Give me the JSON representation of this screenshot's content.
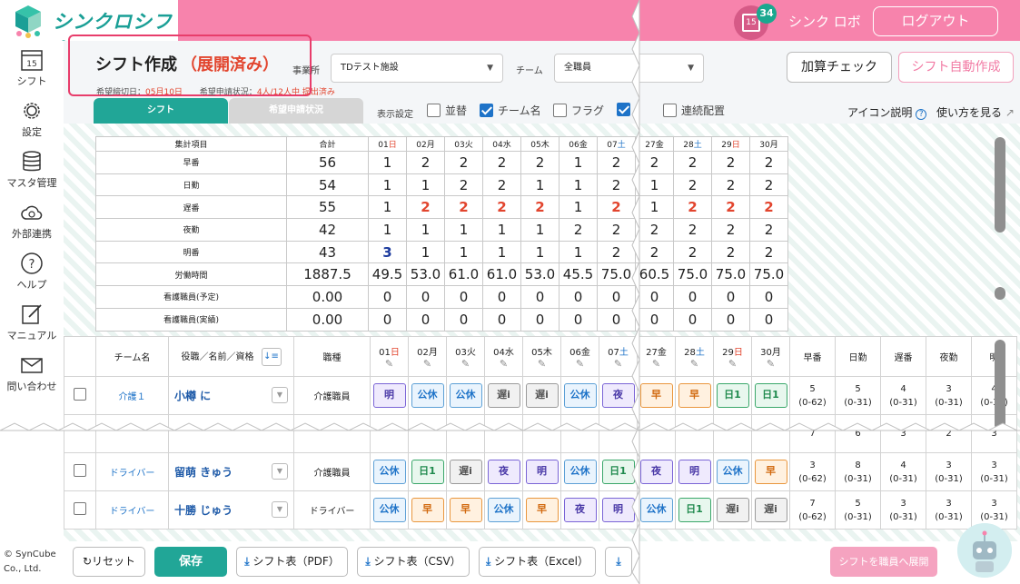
{
  "header": {
    "logo_text": "シンクロシフト",
    "cal_day": "15",
    "notif_count": "34",
    "user": "シンク ロボ",
    "logout": "ログアウト"
  },
  "sidebar": {
    "items": [
      {
        "label": "シフト",
        "icon": "calendar-icon"
      },
      {
        "label": "設定",
        "icon": "gear-icon"
      },
      {
        "label": "マスタ管理",
        "icon": "database-icon"
      },
      {
        "label": "外部連携",
        "icon": "cloud-sync-icon"
      },
      {
        "label": "ヘルプ",
        "icon": "help-icon"
      },
      {
        "label": "マニュアル",
        "icon": "manual-icon"
      },
      {
        "label": "問い合わせ",
        "icon": "mail-icon"
      }
    ],
    "cal_day": "15",
    "copyright_1": "© SynCube",
    "copyright_2": "Co., Ltd."
  },
  "page": {
    "title": "シフト作成",
    "status": "（展開済み）",
    "deadline_label": "希望締切日：",
    "deadline_value": "05月10日",
    "request_label": "希望申請状況：",
    "request_value": "4人/12人中 提出済み",
    "office_label": "事業所",
    "office_value": "TDテスト施設",
    "team_label": "チーム",
    "team_value": "全職員",
    "addon_check": "加算チェック",
    "auto_create": "シフト自動作成"
  },
  "tabs": {
    "shift": "シフト",
    "request": "希望申請状況"
  },
  "display": {
    "label": "表示設定",
    "options": [
      {
        "label": "並替",
        "checked": false
      },
      {
        "label": "チーム名",
        "checked": true
      },
      {
        "label": "フラグ",
        "checked": false
      },
      {
        "label": "",
        "checked": true
      },
      {
        "label": "連続配置",
        "checked": false
      }
    ],
    "icon_help": "アイコン説明",
    "usage": "使い方を見る"
  },
  "summary": {
    "header": {
      "item": "集計項目",
      "total": "合計"
    },
    "days": [
      {
        "num": "01",
        "dow": "日",
        "type": "sun"
      },
      {
        "num": "02",
        "dow": "月",
        "type": ""
      },
      {
        "num": "03",
        "dow": "火",
        "type": ""
      },
      {
        "num": "04",
        "dow": "水",
        "type": ""
      },
      {
        "num": "05",
        "dow": "木",
        "type": ""
      },
      {
        "num": "06",
        "dow": "金",
        "type": ""
      },
      {
        "num": "07",
        "dow": "土",
        "type": "sat"
      },
      {
        "num": "27",
        "dow": "金",
        "type": ""
      },
      {
        "num": "28",
        "dow": "土",
        "type": "sat"
      },
      {
        "num": "29",
        "dow": "日",
        "type": "sun"
      },
      {
        "num": "30",
        "dow": "月",
        "type": ""
      }
    ],
    "rows": [
      {
        "label": "早番",
        "total": "56",
        "values": [
          "1",
          "2",
          "2",
          "2",
          "2",
          "1",
          "2",
          "2",
          "2",
          "2",
          "2"
        ],
        "style": ""
      },
      {
        "label": "日勤",
        "total": "54",
        "values": [
          "1",
          "1",
          "2",
          "2",
          "1",
          "1",
          "2",
          "1",
          "2",
          "2",
          "2"
        ],
        "style": ""
      },
      {
        "label": "遅番",
        "total": "55",
        "values": [
          "1",
          "2",
          "2",
          "2",
          "2",
          "1",
          "2",
          "1",
          "2",
          "2",
          "2"
        ],
        "style": "red"
      },
      {
        "label": "夜勤",
        "total": "42",
        "values": [
          "1",
          "1",
          "1",
          "1",
          "1",
          "2",
          "2",
          "2",
          "2",
          "2",
          "2"
        ],
        "style": ""
      },
      {
        "label": "明番",
        "total": "43",
        "values": [
          "3",
          "1",
          "1",
          "1",
          "1",
          "1",
          "2",
          "2",
          "2",
          "2",
          "2"
        ],
        "style": "first-blue"
      },
      {
        "label": "労働時間",
        "total": "1887.5",
        "values": [
          "49.5",
          "53.0",
          "61.0",
          "61.0",
          "53.0",
          "45.5",
          "75.0",
          "60.5",
          "75.0",
          "75.0",
          "75.0"
        ],
        "style": ""
      },
      {
        "label": "看護職員(予定)",
        "total": "0.00",
        "values": [
          "0",
          "0",
          "0",
          "0",
          "0",
          "0",
          "0",
          "0",
          "0",
          "0",
          "0"
        ],
        "style": ""
      },
      {
        "label": "看護職員(実績)",
        "total": "0.00",
        "values": [
          "0",
          "0",
          "0",
          "0",
          "0",
          "0",
          "0",
          "0",
          "0",
          "0",
          "0"
        ],
        "style": ""
      }
    ]
  },
  "staff": {
    "header": {
      "team": "チーム名",
      "role": "役職／名前／資格",
      "job": "職種"
    },
    "count_headers": [
      "早番",
      "日勤",
      "遅番",
      "夜勤",
      "明"
    ],
    "rows": [
      {
        "team": "介護１",
        "name": "小樽 に",
        "job": "介護職員",
        "shifts": [
          "明",
          "公休",
          "公休",
          "遅i",
          "遅i",
          "公休",
          "夜",
          "早",
          "早",
          "日1",
          "日1"
        ],
        "counts": [
          [
            "5",
            "(0-62)"
          ],
          [
            "5",
            "(0-31)"
          ],
          [
            "4",
            "(0-31)"
          ],
          [
            "3",
            "(0-31)"
          ],
          [
            "4",
            "(0-31)"
          ]
        ]
      },
      {
        "team": "ドライバー",
        "name": "留萌 きゅう",
        "job": "介護職員",
        "shifts": [
          "公休",
          "日1",
          "遅i",
          "夜",
          "明",
          "公休",
          "日1",
          "夜",
          "明",
          "公休",
          "早"
        ],
        "counts": [
          [
            "3",
            "(0-62)"
          ],
          [
            "8",
            "(0-31)"
          ],
          [
            "4",
            "(0-31)"
          ],
          [
            "3",
            "(0-31)"
          ],
          [
            "3",
            "(0-31)"
          ]
        ]
      },
      {
        "team": "ドライバー",
        "name": "十勝 じゅう",
        "job": "ドライバー",
        "shifts": [
          "公休",
          "早",
          "早",
          "公休",
          "早",
          "夜",
          "明",
          "公休",
          "日1",
          "遅i",
          "遅i"
        ],
        "counts": [
          [
            "7",
            "(0-62)"
          ],
          [
            "5",
            "(0-31)"
          ],
          [
            "3",
            "(0-31)"
          ],
          [
            "3",
            "(0-31)"
          ],
          [
            "3",
            "(0-31)"
          ]
        ]
      }
    ],
    "partial_counts": [
      "7",
      "6",
      "3",
      "2",
      "3"
    ]
  },
  "bottom": {
    "reset": "リセット",
    "save": "保存",
    "pdf": "シフト表（PDF）",
    "csv": "シフト表（CSV）",
    "excel": "シフト表（Excel）",
    "deploy": "シフトを職員へ展開"
  },
  "colors": {
    "pink": "#f783ac",
    "teal": "#21a697",
    "red": "#e2452e",
    "blue": "#1e73c8"
  }
}
